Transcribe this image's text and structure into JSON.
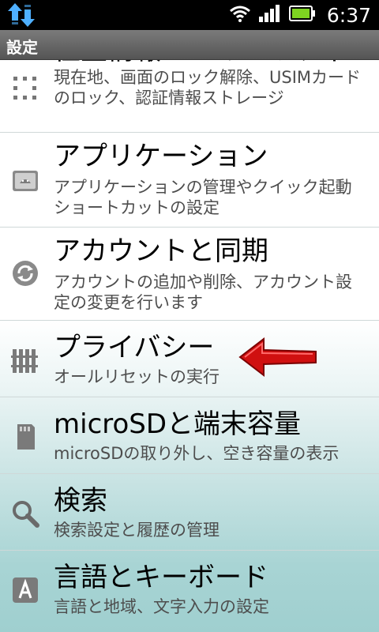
{
  "status_bar": {
    "time": "6:37",
    "icons": [
      "data-transfer-icon",
      "wifi-icon",
      "signal-icon",
      "battery-icon"
    ],
    "battery_color": "#7ed321"
  },
  "title_bar": {
    "title": "設定"
  },
  "settings": {
    "items": [
      {
        "title": "位置情報とセキュリティ",
        "subtitle": "現在地、画面のロック解除、USIMカードのロック、認証情報ストレージ",
        "icon": "grid-dots-icon"
      },
      {
        "title": "アプリケーション",
        "subtitle": "アプリケーションの管理やクイック起動ショートカットの設定",
        "icon": "android-app-icon"
      },
      {
        "title": "アカウントと同期",
        "subtitle": "アカウントの追加や削除、アカウント設定の変更を行います",
        "icon": "sync-icon"
      },
      {
        "title": "プライバシー",
        "subtitle": "オールリセットの実行",
        "icon": "fence-icon"
      },
      {
        "title": "microSDと端末容量",
        "subtitle": "microSDの取り外し、空き容量の表示",
        "icon": "sd-card-icon"
      },
      {
        "title": "検索",
        "subtitle": "検索設定と履歴の管理",
        "icon": "search-icon"
      },
      {
        "title": "言語とキーボード",
        "subtitle": "言語と地域、文字入力の設定",
        "icon": "keyboard-a-icon"
      }
    ]
  },
  "annotation": {
    "arrow_color": "#d01010",
    "icon": "red-arrow-icon"
  }
}
